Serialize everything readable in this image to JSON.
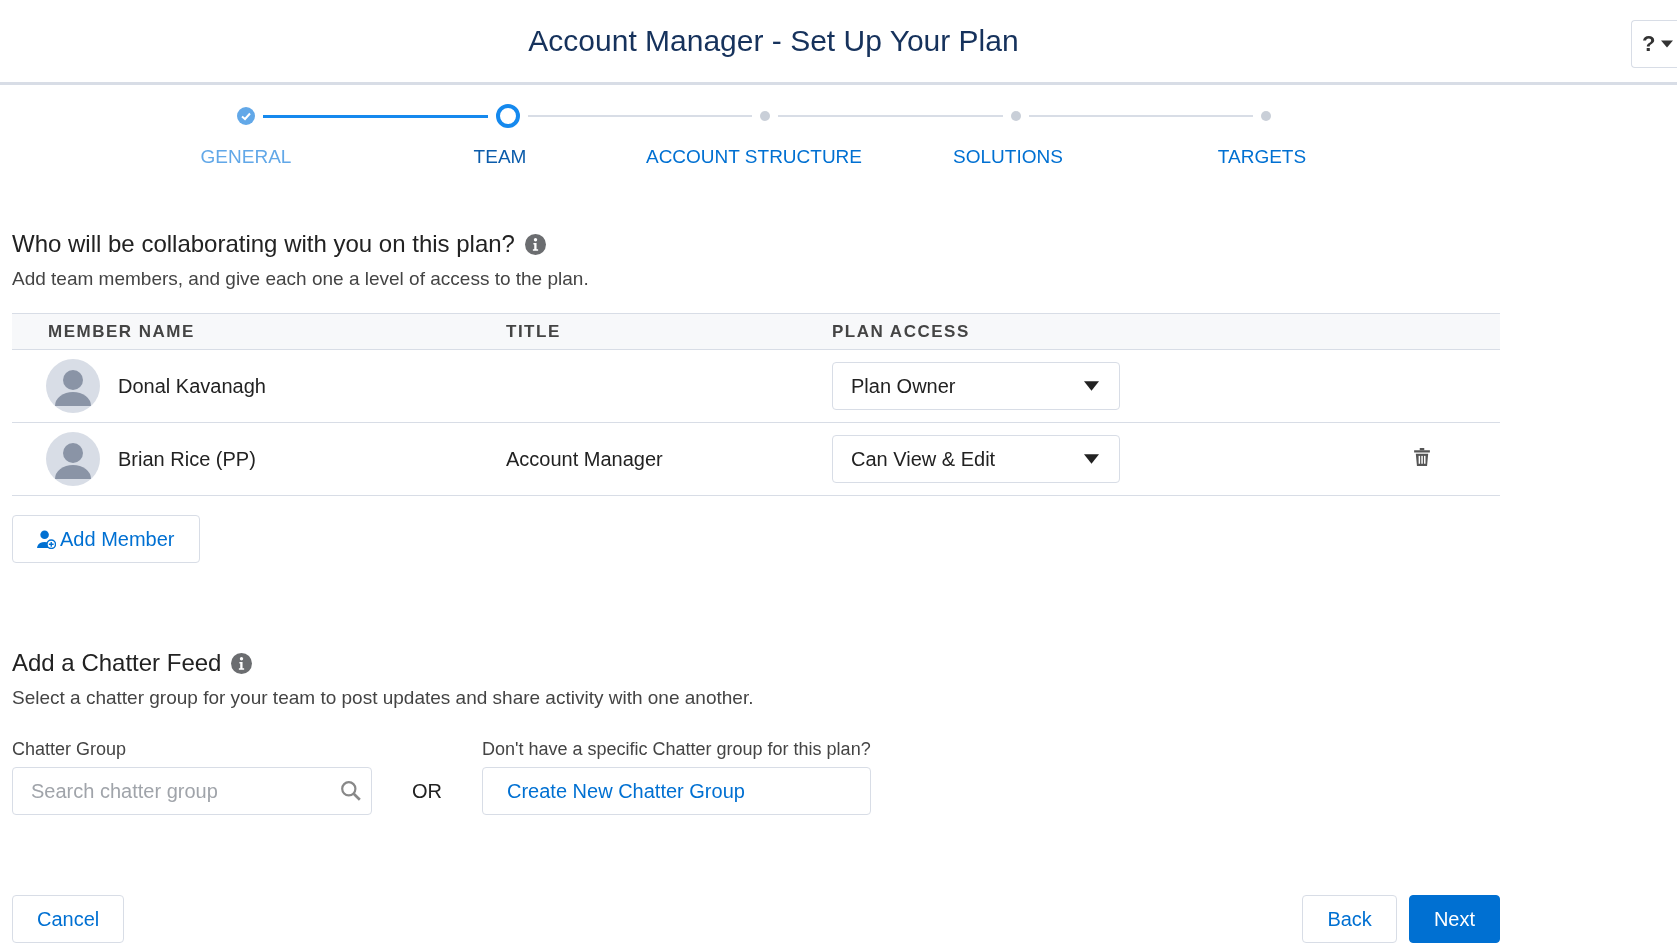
{
  "header": {
    "title": "Account Manager - Set Up Your Plan",
    "help_label": "?"
  },
  "steps": [
    {
      "label": "GENERAL",
      "completed": true,
      "selected": false
    },
    {
      "label": "TEAM",
      "completed": false,
      "selected": true
    },
    {
      "label": "ACCOUNT STRUCTURE",
      "completed": false,
      "selected": false
    },
    {
      "label": "SOLUTIONS",
      "completed": false,
      "selected": false
    },
    {
      "label": "TARGETS",
      "completed": false,
      "selected": false
    }
  ],
  "team": {
    "heading": "Who will be collaborating with you on this plan?",
    "description": "Add team members, and give each one a level of access to the plan.",
    "columns": [
      "MEMBER NAME",
      "TITLE",
      "PLAN ACCESS"
    ],
    "rows": [
      {
        "name": "Donal Kavanagh",
        "access": "Plan Owner",
        "removable": false
      },
      {
        "name": "Brian Rice (PP)",
        "title": "Account Manager",
        "access": "Can View & Edit",
        "removable": true
      }
    ],
    "add_button": "Add Member"
  },
  "chatter": {
    "heading": "Add a Chatter Feed",
    "description": "Select a chatter group for your team to post updates and share activity with one another.",
    "field_label": "Chatter Group",
    "placeholder": "Search chatter group",
    "or_label": "OR",
    "alt_prompt": "Don't have a specific Chatter group for this plan?",
    "create_button": "Create New Chatter Group"
  },
  "footer": {
    "cancel": "Cancel",
    "back": "Back",
    "next": "Next"
  }
}
